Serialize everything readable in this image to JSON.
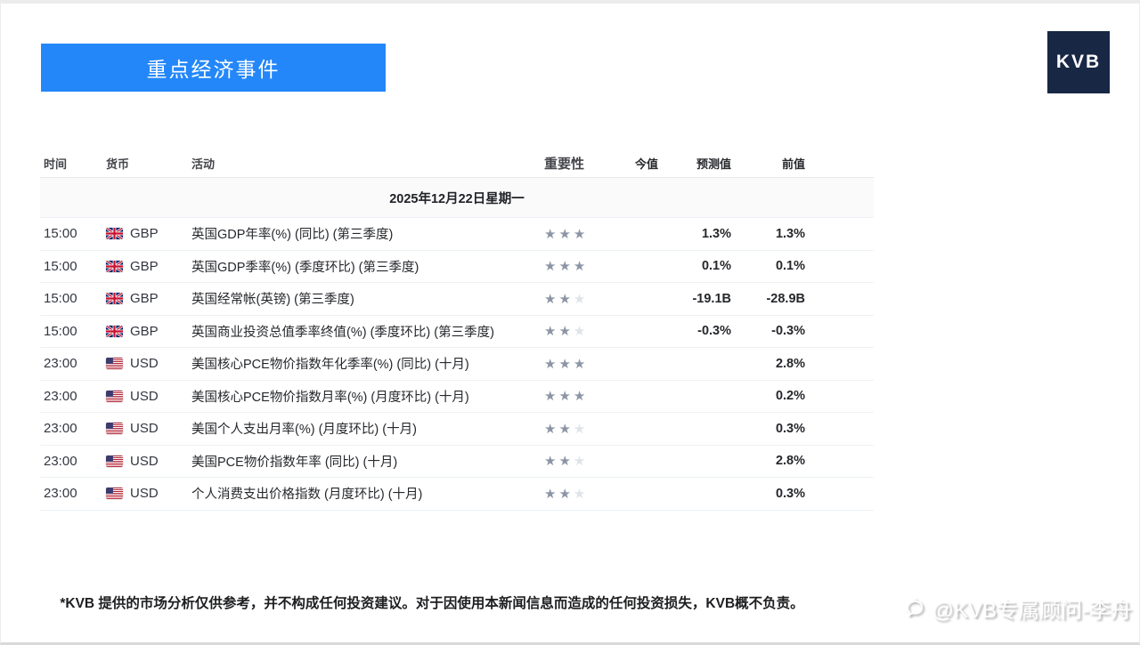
{
  "page": {
    "banner_title": "重点经济事件",
    "logo_text": "KVB",
    "accent_color": "#2387fa",
    "logo_bg_color": "#182744"
  },
  "table": {
    "headers": {
      "time": "时间",
      "currency": "货币",
      "activity": "活动",
      "importance": "重要性",
      "actual": "今值",
      "forecast": "预测值",
      "previous": "前值"
    },
    "date_header": "2025年12月22日星期一",
    "importance_max": 3,
    "rows": [
      {
        "time": "15:00",
        "currency": "GBP",
        "flag": "gb",
        "activity": "英国GDP年率(%) (同比) (第三季度)",
        "importance": 3,
        "actual": "",
        "forecast": "1.3%",
        "previous": "1.3%"
      },
      {
        "time": "15:00",
        "currency": "GBP",
        "flag": "gb",
        "activity": "英国GDP季率(%) (季度环比) (第三季度)",
        "importance": 3,
        "actual": "",
        "forecast": "0.1%",
        "previous": "0.1%"
      },
      {
        "time": "15:00",
        "currency": "GBP",
        "flag": "gb",
        "activity": "英国经常帐(英镑) (第三季度)",
        "importance": 2,
        "actual": "",
        "forecast": "-19.1B",
        "previous": "-28.9B"
      },
      {
        "time": "15:00",
        "currency": "GBP",
        "flag": "gb",
        "activity": "英国商业投资总值季率终值(%) (季度环比) (第三季度)",
        "importance": 2,
        "actual": "",
        "forecast": "-0.3%",
        "previous": "-0.3%"
      },
      {
        "time": "23:00",
        "currency": "USD",
        "flag": "us",
        "activity": "美国核心PCE物价指数年化季率(%) (同比) (十月)",
        "importance": 3,
        "actual": "",
        "forecast": "",
        "previous": "2.8%"
      },
      {
        "time": "23:00",
        "currency": "USD",
        "flag": "us",
        "activity": "美国核心PCE物价指数月率(%) (月度环比) (十月)",
        "importance": 3,
        "actual": "",
        "forecast": "",
        "previous": "0.2%"
      },
      {
        "time": "23:00",
        "currency": "USD",
        "flag": "us",
        "activity": "美国个人支出月率(%) (月度环比) (十月)",
        "importance": 2,
        "actual": "",
        "forecast": "",
        "previous": "0.3%"
      },
      {
        "time": "23:00",
        "currency": "USD",
        "flag": "us",
        "activity": "美国PCE物价指数年率 (同比) (十月)",
        "importance": 2,
        "actual": "",
        "forecast": "",
        "previous": "2.8%"
      },
      {
        "time": "23:00",
        "currency": "USD",
        "flag": "us",
        "activity": "个人消费支出价格指数 (月度环比) (十月)",
        "importance": 2,
        "actual": "",
        "forecast": "",
        "previous": "0.3%"
      }
    ]
  },
  "footer": {
    "disclaimer": "*KVB 提供的市场分析仅供参考，并不构成任何投资建议。对于因使用本新闻信息而造成的任何投资损失，KVB概不负责。",
    "watermark": "@KVB专属顾问-李舟"
  },
  "colors": {
    "star_filled": "#8d95a5",
    "star_empty": "#e0e3e8"
  }
}
